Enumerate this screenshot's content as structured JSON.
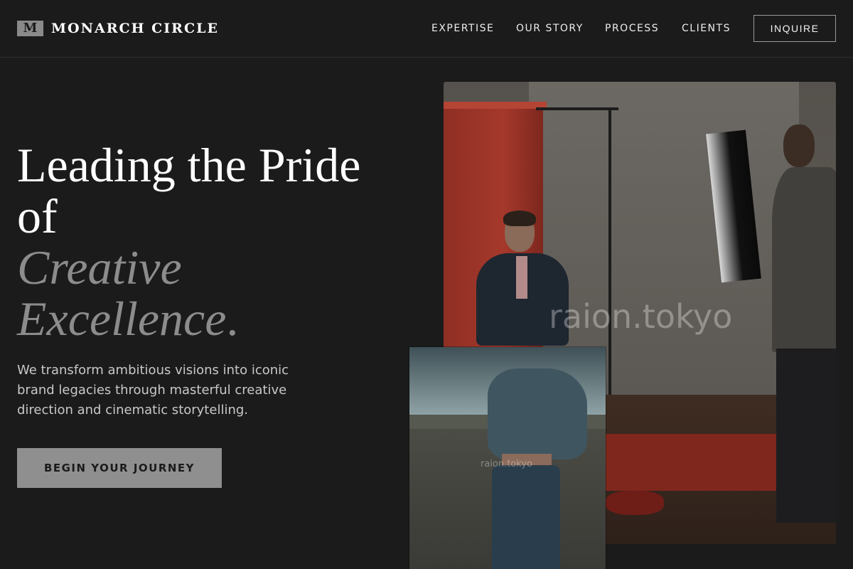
{
  "brand": {
    "mark": "M",
    "name": "MONARCH CIRCLE"
  },
  "nav": {
    "items": [
      {
        "label": "EXPERTISE"
      },
      {
        "label": "OUR STORY"
      },
      {
        "label": "PROCESS"
      },
      {
        "label": "CLIENTS"
      }
    ],
    "cta_label": "INQUIRE"
  },
  "hero": {
    "headline_line1": "Leading the Pride",
    "headline_line2": "of",
    "headline_accent1": "Creative",
    "headline_accent2": "Excellence",
    "headline_period": ".",
    "description": "We transform ambitious visions into iconic brand legacies through masterful creative direction and cinematic storytelling.",
    "cta_label": "BEGIN YOUR JOURNEY"
  },
  "gallery": {
    "main_watermark": "raion.tokyo",
    "inset_watermark": "raion.tokyo"
  },
  "colors": {
    "background": "#1b1b1b",
    "accent_gray": "#8c8c8c",
    "text": "#ffffff"
  }
}
